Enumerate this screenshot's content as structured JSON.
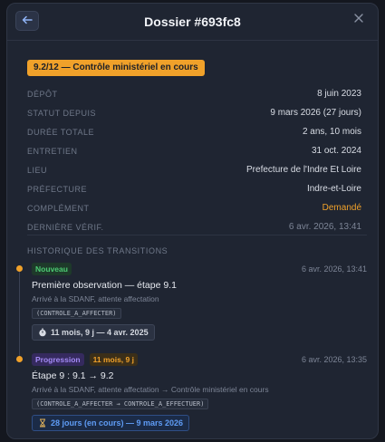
{
  "header": {
    "title": "Dossier #693fc8",
    "back_icon": "arrow-left-icon",
    "close_icon": "close-icon"
  },
  "status": {
    "label": "9.2/12 — Contrôle ministériel en cours",
    "color": "#f0a12a"
  },
  "info": [
    {
      "key": "DÉPÔT",
      "value": "8 juin 2023"
    },
    {
      "key": "STATUT DEPUIS",
      "value": "9 mars 2026 (27 jours)"
    },
    {
      "key": "DURÉE TOTALE",
      "value": "2 ans, 10 mois"
    },
    {
      "key": "ENTRETIEN",
      "value": "31 oct. 2024"
    },
    {
      "key": "LIEU",
      "value": "Prefecture de l'Indre Et Loire"
    },
    {
      "key": "PRÉFECTURE",
      "value": "Indre-et-Loire"
    },
    {
      "key": "COMPLÉMENT",
      "value": "Demandé"
    },
    {
      "key": "DERNIÈRE VÉRIF.",
      "value": "6 avr. 2026, 13:41"
    }
  ],
  "history": {
    "title": "HISTORIQUE DES TRANSITIONS",
    "entries": [
      {
        "tag": "Nouveau",
        "timestamp": "6 avr. 2026, 13:41",
        "title": "Première observation — étape 9.1",
        "subtitle": "Arrivé à la SDANF, attente affectation",
        "code": "(CONTROLE_A_AFFECTER)",
        "duration": "11 mois, 9 j — 4 avr. 2025",
        "duration_icon": "stopwatch-icon"
      },
      {
        "tag": "Progression",
        "tag2": "11 mois, 9 j",
        "timestamp": "6 avr. 2026, 13:35",
        "title": "Étape 9 : 9.1 → 9.2",
        "subtitle": "Arrivé à la SDANF, attente affectation → Contrôle ministériel en cours",
        "code": "(CONTROLE_A_AFFECTER → CONTROLE_A_EFFECTUER)",
        "duration": "28 jours (en cours) — 9 mars 2026",
        "duration_icon": "hourglass-icon"
      }
    ]
  }
}
